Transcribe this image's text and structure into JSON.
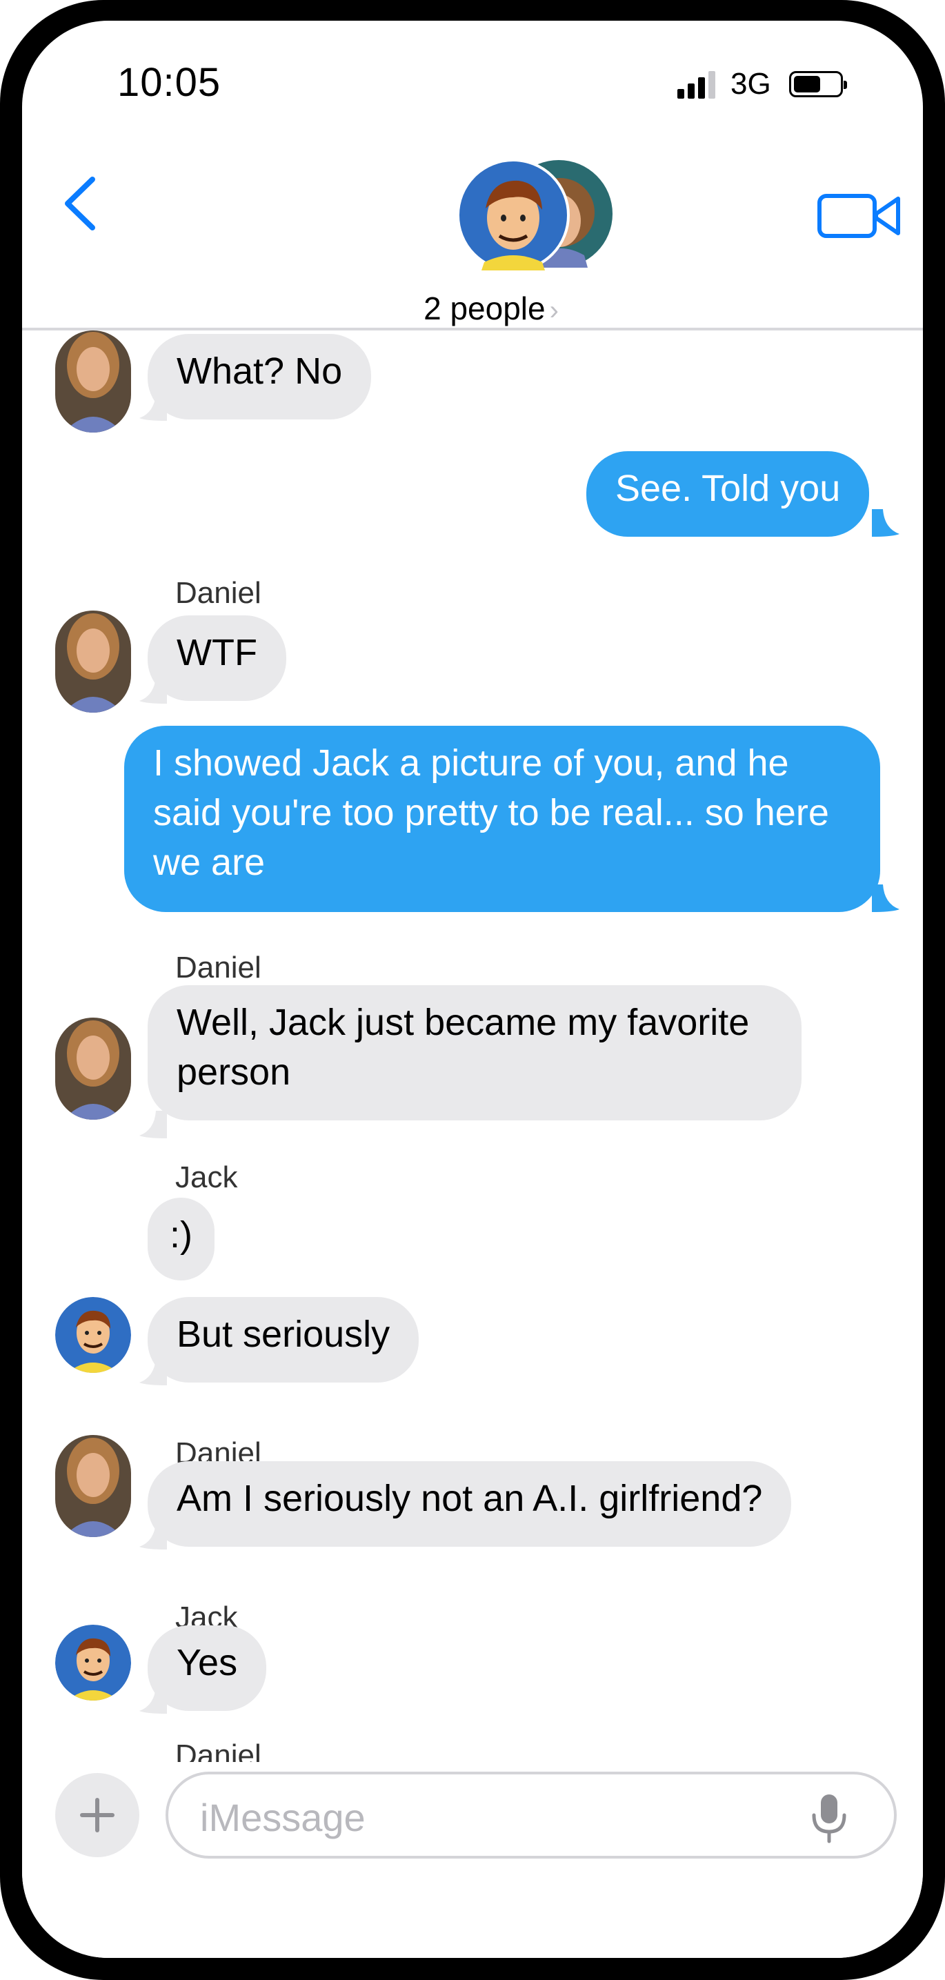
{
  "status_bar": {
    "time": "10:05",
    "network": "3G"
  },
  "header": {
    "group_label": "2 people"
  },
  "messages": [
    {
      "direction": "in",
      "sender": "",
      "text": "What?  No"
    },
    {
      "direction": "out",
      "text": "See. Told you"
    },
    {
      "direction": "in",
      "sender": "Daniel",
      "text": "WTF"
    },
    {
      "direction": "out",
      "lines": [
        "I showed Jack a picture of you, and he",
        "said you're too pretty to be real... so here",
        "we are"
      ]
    },
    {
      "direction": "in",
      "sender": "Daniel",
      "lines": [
        "Well, Jack just became my favorite",
        "person"
      ]
    },
    {
      "direction": "in",
      "sender": "Jack",
      "text": ":)"
    },
    {
      "direction": "in",
      "sender": "",
      "text": "But seriously"
    },
    {
      "direction": "in",
      "sender": "Daniel",
      "text": "Am I seriously not an A.I. girlfriend?"
    },
    {
      "direction": "in",
      "sender": "Jack",
      "text": "Yes"
    },
    {
      "direction": "in",
      "sender": "Daniel",
      "text": ""
    }
  ],
  "composer": {
    "placeholder": "iMessage"
  },
  "colors": {
    "accent": "#0a7cff",
    "outgoing_bubble": "#2ea3f2",
    "incoming_bubble": "#e9e9eb"
  },
  "icons": {
    "back": "chevron-left-icon",
    "video": "video-camera-icon",
    "plus": "plus-icon",
    "mic": "microphone-icon"
  }
}
